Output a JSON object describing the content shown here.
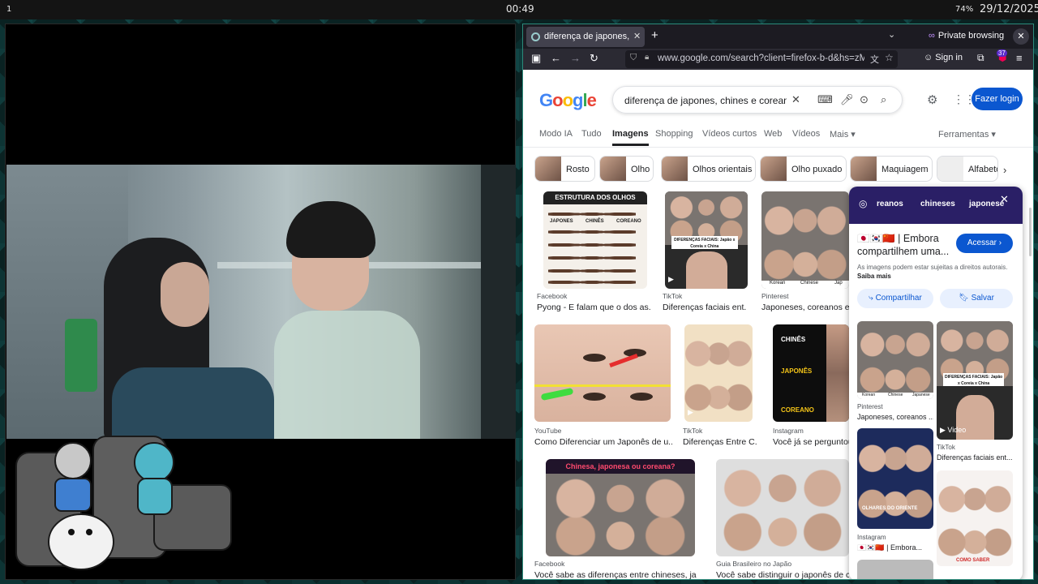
{
  "topbar": {
    "workspace": "1",
    "clock": "00:49",
    "battery": "74%",
    "date": "29/12/2025"
  },
  "browser": {
    "tab_title": "diferença de japones, c",
    "tab_close": "✕",
    "new_tab": "+",
    "tabs_dropdown": "⌄",
    "private_label": "Private browsing",
    "private_icon": "∞",
    "window_close": "✕",
    "nav": {
      "back": "←",
      "forward": "→",
      "reload": "↻",
      "url": "www.google.com/search?client=firefox-b-d&hs=zM",
      "translate": "文",
      "bookmark": "☆",
      "sign_in": "Sign in",
      "extensions_badge": "37",
      "menu": "≡"
    }
  },
  "google": {
    "logo": [
      "G",
      "o",
      "o",
      "g",
      "l",
      "e"
    ],
    "query": "diferença de japones, chines e coreano",
    "login": "Fazer login",
    "tabs": [
      "Modo IA",
      "Tudo",
      "Imagens",
      "Shopping",
      "Vídeos curtos",
      "Web",
      "Vídeos",
      "Mais ▾"
    ],
    "tools": "Ferramentas ▾",
    "chips": [
      "Rosto",
      "Olho",
      "Olhos orientais",
      "Olho puxado",
      "Maquiagem",
      "Alfabeto"
    ],
    "results": [
      {
        "source": "Facebook",
        "title": "Pyong - E falam que o dos as..."
      },
      {
        "source": "TikTok",
        "title": "Diferenças faciais ent..."
      },
      {
        "source": "Pinterest",
        "title": "Japoneses, coreanos e c"
      },
      {
        "source": "YouTube",
        "title": "Como Diferenciar um Japonês de u..."
      },
      {
        "source": "TikTok",
        "title": "Diferenças Entre C..."
      },
      {
        "source": "Instagram",
        "title": "Você já se perguntou"
      },
      {
        "source": "Facebook",
        "title": "Você sabe as diferenças entre chineses, japo..."
      },
      {
        "source": "Guia Brasileiro no Japão",
        "title": "Você sabe distinguir o japonês de coreano..."
      }
    ],
    "image_text": {
      "eyes_header": "ESTRUTURA DOS OLHOS",
      "eyes_cols": [
        "JAPONES",
        "CHINÊS",
        "COREANO"
      ],
      "tiktok_bar": "DIFERENÇAS FACIAIS: Japão x Coreia x China",
      "pinterest_labels": [
        "Korean",
        "Chinese",
        "Jap"
      ],
      "black_labels": [
        "CHINÊS",
        "JAPONÊS",
        "COREANO"
      ],
      "pink_header": "Chinesa, japonesa ou coreana?"
    },
    "panel": {
      "hero_words": [
        "reanos",
        "chineses",
        "japonese"
      ],
      "title": "🇯🇵🇰🇷🇨🇳 | Embora compartilhem uma...",
      "acessar": "Acessar ›",
      "note": "As imagens podem estar sujeitas a direitos autorais.",
      "note_link": "Saiba mais",
      "share": "Compartilhar",
      "save": "Salvar",
      "cards": [
        {
          "source": "Pinterest",
          "title": "Japoneses, coreanos ..."
        },
        {
          "source": "TikTok",
          "title": "Diferenças faciais ent..."
        },
        {
          "source": "Instagram",
          "title": "🇯🇵🇰🇷🇨🇳 | Embora..."
        }
      ],
      "video_label": "Video",
      "card_text": [
        "OLHARES DO ORIENTE",
        "COMO SABER"
      ],
      "pinterest_labels": [
        "Korean",
        "Chinese",
        "Japanese"
      ]
    }
  },
  "colors": {
    "accent": "#0b57d0",
    "browser_chrome": "#2b2a33",
    "private_purple": "#c291ff"
  }
}
